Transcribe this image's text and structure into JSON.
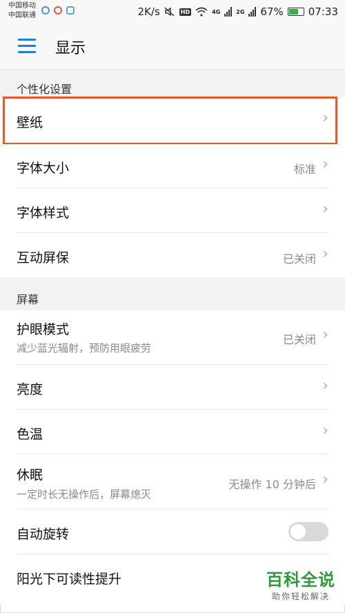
{
  "status_bar": {
    "carrier1": "中国移动",
    "carrier2": "中国联通",
    "speed": "2K/s",
    "hd": "HD",
    "net4g": "4G",
    "net2g": "2G",
    "battery": "67%",
    "time": "07:33"
  },
  "header": {
    "title": "显示"
  },
  "sections": {
    "personal": "个性化设置",
    "screen": "屏幕"
  },
  "rows": {
    "wallpaper": {
      "label": "壁纸"
    },
    "font_size": {
      "label": "字体大小",
      "value": "标准"
    },
    "font_style": {
      "label": "字体样式"
    },
    "screensaver": {
      "label": "互动屏保",
      "value": "已关闭"
    },
    "eye_mode": {
      "label": "护眼模式",
      "sub": "减少蓝光辐射，预防用眼疲劳",
      "value": "已关闭"
    },
    "brightness": {
      "label": "亮度"
    },
    "color_temp": {
      "label": "色温"
    },
    "sleep": {
      "label": "休眠",
      "sub": "一定时长无操作后，屏幕熄灭",
      "value": "无操作 10 分钟后"
    },
    "auto_rotate": {
      "label": "自动旋转",
      "on": false
    },
    "sunlight": {
      "label": "阳光下可读性提升"
    }
  },
  "watermark": {
    "main": "百科全说",
    "sub": "助你轻松解决"
  },
  "colors": {
    "accent": "#1f7fd8",
    "highlight": "#e45a2a",
    "watermark": "#2e9a3a"
  }
}
